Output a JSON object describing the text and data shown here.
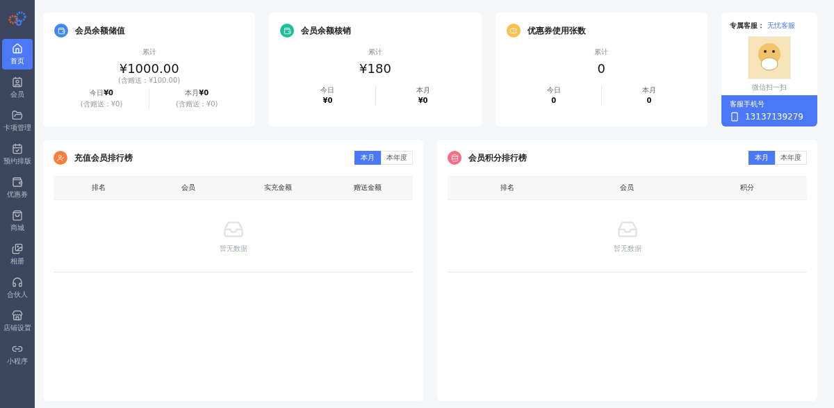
{
  "sidebar": {
    "items": [
      {
        "label": "首页",
        "selected": true
      },
      {
        "label": "会员",
        "selected": false
      },
      {
        "label": "卡项管理",
        "selected": false
      },
      {
        "label": "预约排版",
        "selected": false
      },
      {
        "label": "优惠券",
        "selected": false
      },
      {
        "label": "商城",
        "selected": false
      },
      {
        "label": "相册",
        "selected": false
      },
      {
        "label": "合伙人",
        "selected": false
      },
      {
        "label": "店铺设置",
        "selected": false
      },
      {
        "label": "小程序",
        "selected": false
      }
    ]
  },
  "stat_cards": [
    {
      "title": "会员余额储值",
      "color": "#3d8af7",
      "kind": "inline",
      "total_label": "累计",
      "total": "¥1000.00",
      "total_note": "(含赠送：¥100.00)",
      "periods": [
        {
          "label": "今日",
          "value": "¥0",
          "note": "(含赠送：¥0)"
        },
        {
          "label": "本月",
          "value": "¥0",
          "note": "(含赠送：¥0)"
        }
      ]
    },
    {
      "title": "会员余额核销",
      "color": "#19bf95",
      "kind": "stacked",
      "total_label": "累计",
      "total": "¥180",
      "periods": [
        {
          "label": "今日",
          "value": "¥0"
        },
        {
          "label": "本月",
          "value": "¥0"
        }
      ]
    },
    {
      "title": "优惠券使用张数",
      "color": "#fbbf4d",
      "kind": "stacked",
      "total_label": "累计",
      "total": "0",
      "periods": [
        {
          "label": "今日",
          "value": "0"
        },
        {
          "label": "本月",
          "value": "0"
        }
      ]
    }
  ],
  "service": {
    "label": "专属客服：",
    "name": "无忧客服",
    "qr_caption": "微信扫一扫",
    "phone_label": "客服手机号",
    "phone": "13137139279"
  },
  "rankings": [
    {
      "title": "充值会员排行榜",
      "color": "#fb7d3c",
      "tabs": [
        {
          "label": "本月",
          "selected": true
        },
        {
          "label": "本年度",
          "selected": false
        }
      ],
      "columns": [
        "排名",
        "会员",
        "实充金额",
        "赠送金额"
      ],
      "empty_text": "暂无数据"
    },
    {
      "title": "会员积分排行榜",
      "color": "#f86c85",
      "tabs": [
        {
          "label": "本月",
          "selected": true
        },
        {
          "label": "本年度",
          "selected": false
        }
      ],
      "columns": [
        "排名",
        "会员",
        "积分"
      ],
      "empty_text": "暂无数据"
    }
  ]
}
